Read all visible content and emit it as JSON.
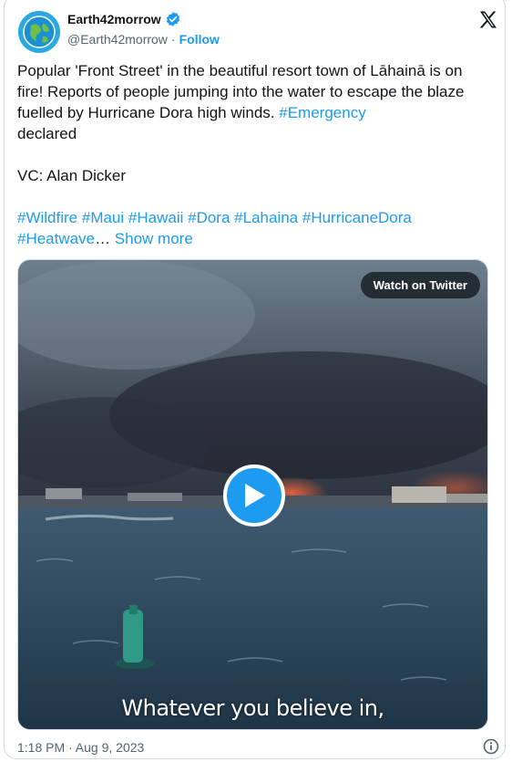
{
  "author": {
    "display_name": "Earth42morrow",
    "handle": "@Earth42morrow",
    "separator": "·",
    "follow_label": "Follow",
    "avatar_icon": "globe-avatar-icon",
    "verified_icon": "verified-badge-icon"
  },
  "tweet": {
    "line_1": "Popular 'Front Street' in the beautiful resort town of Lāhainā is on fire! Reports of people jumping into the water to escape the blaze fuelled by Hurricane Dora high winds. ",
    "tag_emergency": "#Emergency",
    "line_1_end": "\ndeclared\n\nVC: Alan Dicker\n\n",
    "hashtags": [
      "#Wildfire",
      "#Maui",
      "#Hawaii",
      "#Dora",
      "#Lahaina",
      "#HurricaneDora",
      "#Heatwave"
    ],
    "ellipsis": "…",
    "show_more": "Show more"
  },
  "media": {
    "watch_label": "Watch on Twitter",
    "caption": "Whatever you believe in,",
    "play_icon": "play-icon"
  },
  "footer": {
    "timestamp": "1:18 PM · Aug 9, 2023",
    "info_icon": "info-icon"
  },
  "colors": {
    "accent": "#1d9bf0",
    "text": "#0f1419",
    "muted": "#536471",
    "border": "#cfd9de"
  }
}
